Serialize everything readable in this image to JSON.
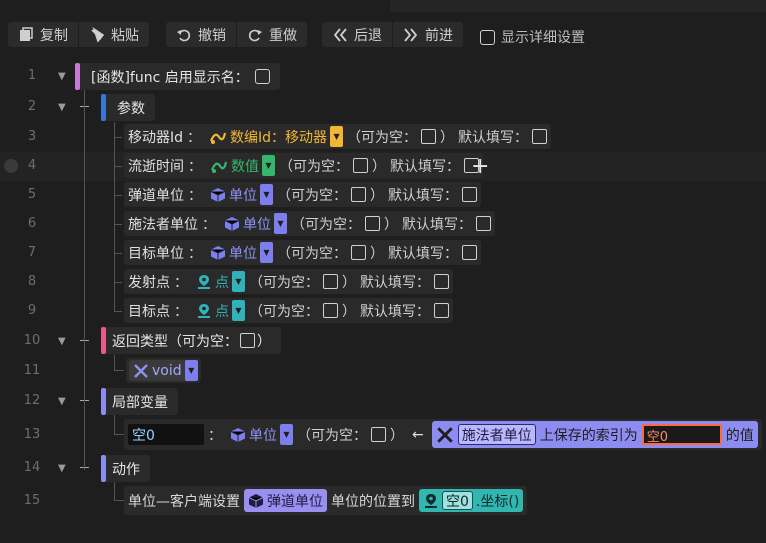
{
  "toolbar": {
    "copy": "复制",
    "paste": "粘贴",
    "undo": "撤销",
    "redo": "重做",
    "back": "后退",
    "forward": "前进",
    "show_details": "显示详细设置"
  },
  "colors": {
    "accent_func": "#c77ad3",
    "accent_params": "#3a78d8",
    "accent_return": "#e85a8a",
    "accent_local": "#8a8ef0",
    "accent_action": "#8a8ef0",
    "type_mover": "#f2b632",
    "type_number": "#33b86b",
    "type_unit": "#7d7fee",
    "type_point": "#2fb2b8"
  },
  "lines": [
    "1",
    "2",
    "3",
    "4",
    "5",
    "6",
    "7",
    "8",
    "9",
    "10",
    "11",
    "12",
    "13",
    "14",
    "15"
  ],
  "func": {
    "label": "[函数]func 启用显示名："
  },
  "params_header": "参数",
  "common": {
    "nullable": "（可为空：",
    "close": "）",
    "default": "默认填写：",
    "colon": "："
  },
  "params": [
    {
      "name": "移动器Id",
      "type": "数编Id：移动器",
      "icon": "mover-icon"
    },
    {
      "name": "流逝时间",
      "type": "数值",
      "icon": "number-icon"
    },
    {
      "name": "弹道单位",
      "type": "单位",
      "icon": "unit-cube-icon"
    },
    {
      "name": "施法者单位",
      "type": "单位",
      "icon": "unit-cube-icon"
    },
    {
      "name": "目标单位",
      "type": "单位",
      "icon": "unit-cube-icon"
    },
    {
      "name": "发射点",
      "type": "点",
      "icon": "point-pin-icon"
    },
    {
      "name": "目标点",
      "type": "点",
      "icon": "point-pin-icon"
    }
  ],
  "return_type": {
    "label": "返回类型（可为空：",
    "close": "）",
    "type": "void"
  },
  "locals_header": "局部变量",
  "local_var": {
    "name": "空0",
    "type": "单位",
    "nullable": "（可为空：",
    "close": "）",
    "assign_arrow": "←",
    "expr_target": "施法者单位",
    "expr_text": "上保存的索引为",
    "expr_index": "空0",
    "expr_suffix": "的值"
  },
  "actions_header": "动作",
  "action": {
    "prefix": "单位—客户端设置",
    "unit": "弹道单位",
    "middle": "单位的位置到",
    "var": "空0",
    "method": ".坐标()"
  }
}
